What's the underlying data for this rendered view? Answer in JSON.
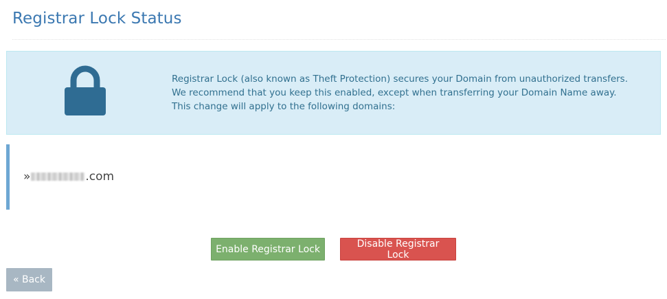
{
  "page": {
    "title": "Registrar Lock Status"
  },
  "info": {
    "icon": "lock-icon",
    "icon_color": "#2f6c93",
    "background_color": "#d9edf7",
    "lines": [
      "Registrar Lock (also known as Theft Protection) secures your Domain from unauthorized transfers.",
      "We recommend that you keep this enabled, except when transferring your Domain Name away.",
      "This change will apply to the following domains:"
    ]
  },
  "domains": {
    "prefix": "»",
    "items": [
      {
        "suffix": ".com"
      }
    ]
  },
  "actions": {
    "enable_label": "Enable Registrar Lock",
    "enable_color": "#7cb06e",
    "disable_label": "Disable Registrar Lock",
    "disable_color": "#d9534f",
    "back_label": "« Back",
    "back_color": "#a8b7c3"
  }
}
